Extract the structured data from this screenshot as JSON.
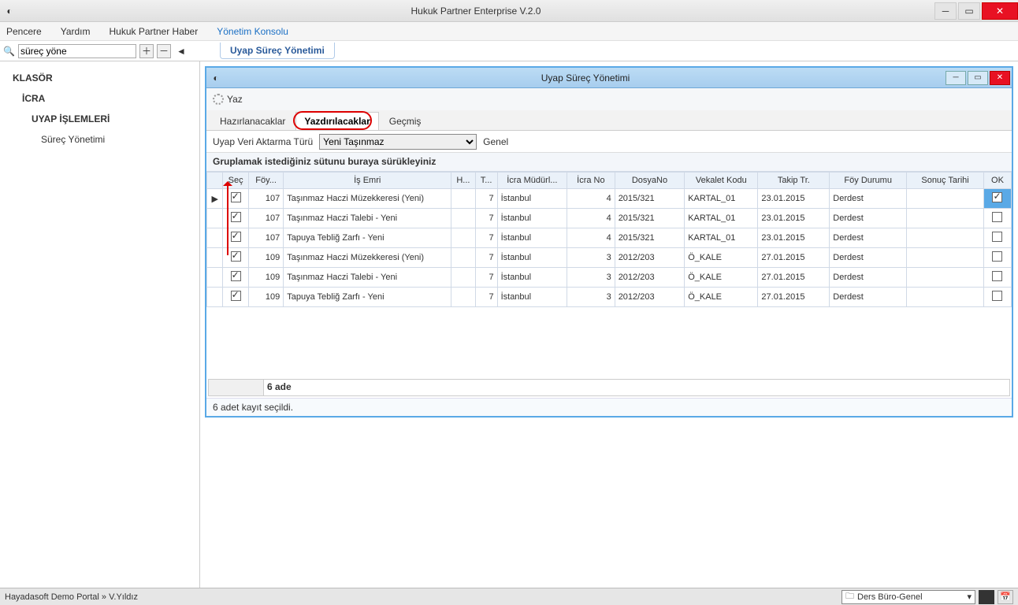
{
  "app": {
    "title": "Hukuk Partner Enterprise V.2.0"
  },
  "menu": {
    "pencere": "Pencere",
    "yardim": "Yardım",
    "haber": "Hukuk Partner Haber",
    "konsol": "Yönetim Konsolu"
  },
  "search": {
    "value": "süreç yöne"
  },
  "toolbar_tab": "Uyap Süreç Yönetimi",
  "sidebar": {
    "klasor": "KLASÖR",
    "icra": "İCRA",
    "uyap": "UYAP İŞLEMLERİ",
    "surec": "Süreç Yönetimi"
  },
  "panel": {
    "title": "Uyap Süreç Yönetimi",
    "print": "Yaz",
    "tabs": {
      "hazir": "Hazırlanacaklar",
      "yazdir": "Yazdırılacaklar",
      "gecmis": "Geçmiş"
    },
    "filter_label": "Uyap Veri Aktarma Türü",
    "filter_value": "Yeni Taşınmaz",
    "filter_genel": "Genel",
    "group_hint": "Gruplamak istediğiniz sütunu buraya sürükleyiniz",
    "columns": {
      "sec": "Seç",
      "foy": "Föy...",
      "isemri": "İş Emri",
      "h": "H...",
      "t": "T...",
      "mud": "İcra Müdürl...",
      "icrano": "İcra No",
      "dosyano": "DosyaNo",
      "vekalet": "Vekalet Kodu",
      "takip": "Takip Tr.",
      "durum": "Föy Durumu",
      "sonuc": "Sonuç Tarihi",
      "ok": "OK"
    },
    "rows": [
      {
        "sec": true,
        "foy": "107",
        "isemri": "Taşınmaz Haczi Müzekkeresi (Yeni)",
        "t": "7",
        "mud": "İstanbul",
        "icrano": "4",
        "dosya": "2015/321",
        "vekalet": "KARTAL_01",
        "takip": "23.01.2015",
        "durum": "Derdest",
        "ok": true,
        "active": true
      },
      {
        "sec": true,
        "foy": "107",
        "isemri": "Taşınmaz Haczi Talebi - Yeni",
        "t": "7",
        "mud": "İstanbul",
        "icrano": "4",
        "dosya": "2015/321",
        "vekalet": "KARTAL_01",
        "takip": "23.01.2015",
        "durum": "Derdest",
        "ok": false
      },
      {
        "sec": true,
        "foy": "107",
        "isemri": "Tapuya Tebliğ Zarfı - Yeni",
        "t": "7",
        "mud": "İstanbul",
        "icrano": "4",
        "dosya": "2015/321",
        "vekalet": "KARTAL_01",
        "takip": "23.01.2015",
        "durum": "Derdest",
        "ok": false
      },
      {
        "sec": true,
        "foy": "109",
        "isemri": "Taşınmaz Haczi Müzekkeresi (Yeni)",
        "t": "7",
        "mud": "İstanbul",
        "icrano": "3",
        "dosya": "2012/203",
        "vekalet": "Ö_KALE",
        "takip": "27.01.2015",
        "durum": "Derdest",
        "ok": false
      },
      {
        "sec": true,
        "foy": "109",
        "isemri": "Taşınmaz Haczi Talebi - Yeni",
        "t": "7",
        "mud": "İstanbul",
        "icrano": "3",
        "dosya": "2012/203",
        "vekalet": "Ö_KALE",
        "takip": "27.01.2015",
        "durum": "Derdest",
        "ok": false
      },
      {
        "sec": true,
        "foy": "109",
        "isemri": "Tapuya Tebliğ Zarfı - Yeni",
        "t": "7",
        "mud": "İstanbul",
        "icrano": "3",
        "dosya": "2012/203",
        "vekalet": "Ö_KALE",
        "takip": "27.01.2015",
        "durum": "Derdest",
        "ok": false
      }
    ],
    "footer_count": "6 ade",
    "status": "6 adet kayıt seçildi."
  },
  "bottom": {
    "portal": "Hayadasoft Demo Portal » V.Yıldız",
    "combo": "Ders Büro-Genel"
  }
}
